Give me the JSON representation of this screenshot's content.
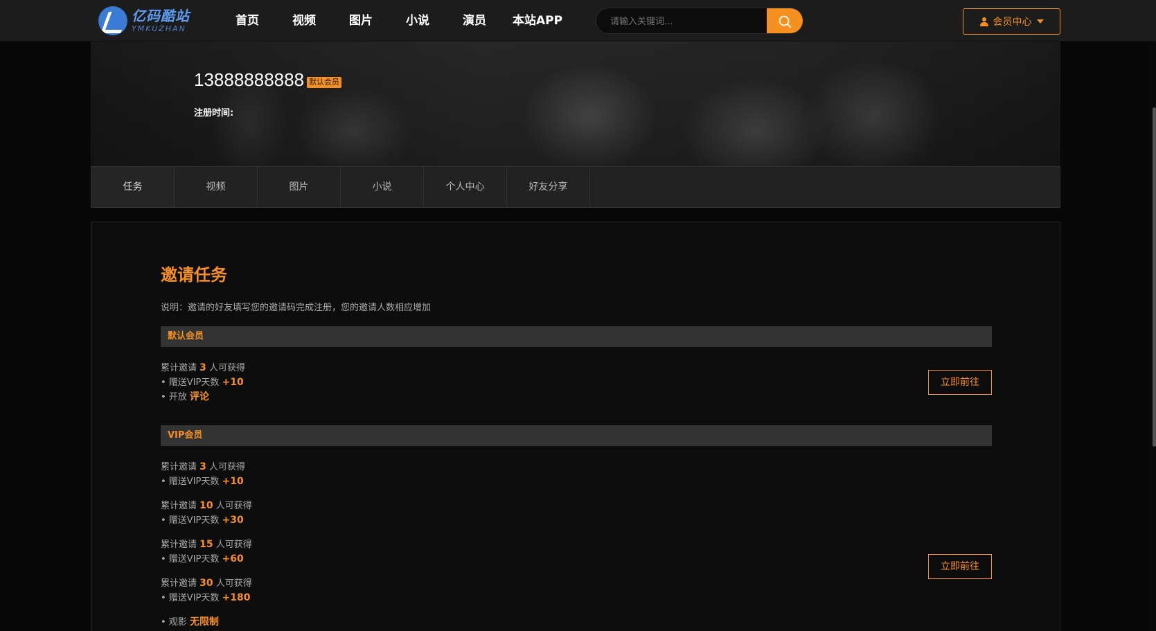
{
  "header": {
    "logo_cn": "亿码酷站",
    "logo_en": "YMKUZHAN",
    "nav": [
      "首页",
      "视频",
      "图片",
      "小说",
      "演员",
      "本站APP"
    ],
    "search_placeholder": "请输入关键词...",
    "member_label": "会员中心",
    "accent_color": "#f7901e"
  },
  "profile": {
    "username": "13888888888",
    "level_badge": "默认会员",
    "register_label": "注册时间:"
  },
  "tabs": [
    "任务",
    "视频",
    "图片",
    "小说",
    "个人中心",
    "好友分享"
  ],
  "task": {
    "title": "邀请任务",
    "description": "说明：邀请的好友填写您的邀请码完成注册，您的邀请人数相应增加",
    "groups": [
      {
        "name": "默认会员",
        "button": "立即前往",
        "invite": {
          "prefix": "累计邀请",
          "count": "3",
          "suffix": "人可获得"
        },
        "rewards": [
          {
            "prefix": "• 赠送VIP天数",
            "value": "+10"
          },
          {
            "prefix": "• 开放",
            "value": "评论"
          }
        ]
      },
      {
        "name": "VIP会员",
        "button": "立即前往",
        "tiers": [
          {
            "prefix": "累计邀请",
            "count": "3",
            "suffix": "人可获得",
            "reward_prefix": "• 赠送VIP天数",
            "reward_value": "+10"
          },
          {
            "prefix": "累计邀请",
            "count": "10",
            "suffix": "人可获得",
            "reward_prefix": "• 赠送VIP天数",
            "reward_value": "+30"
          },
          {
            "prefix": "累计邀请",
            "count": "15",
            "suffix": "人可获得",
            "reward_prefix": "• 赠送VIP天数",
            "reward_value": "+60"
          },
          {
            "prefix": "累计邀请",
            "count": "30",
            "suffix": "人可获得",
            "reward_prefix": "• 赠送VIP天数",
            "reward_value": "+180"
          }
        ],
        "extra": {
          "prefix": "• 观影",
          "value": "无限制"
        }
      }
    ]
  }
}
